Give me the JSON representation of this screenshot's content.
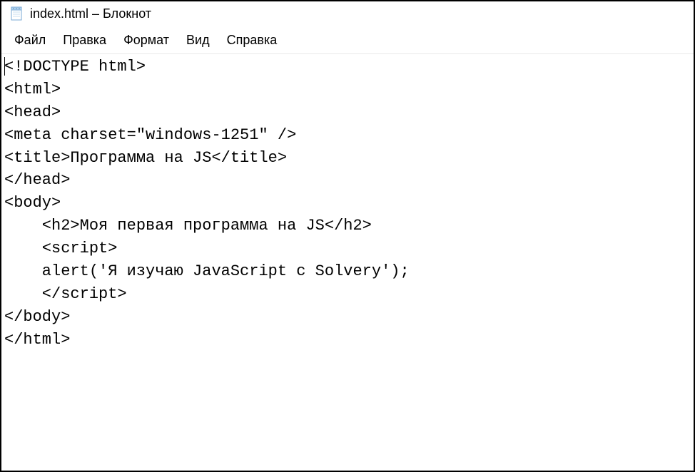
{
  "window": {
    "title": "index.html – Блокнот"
  },
  "menu": {
    "items": [
      "Файл",
      "Правка",
      "Формат",
      "Вид",
      "Справка"
    ]
  },
  "editor": {
    "lines": [
      "<!DOCTYPE html>",
      "<html>",
      "<head>",
      "<meta charset=\"windows-1251\" />",
      "<title>Программа на JS</title>",
      "</head>",
      "<body>",
      "    <h2>Моя первая программа на JS</h2>",
      "    <script>",
      "    alert('Я изучаю JavaScript с Solvery');",
      "    </script>",
      "</body>",
      "</html>"
    ]
  }
}
